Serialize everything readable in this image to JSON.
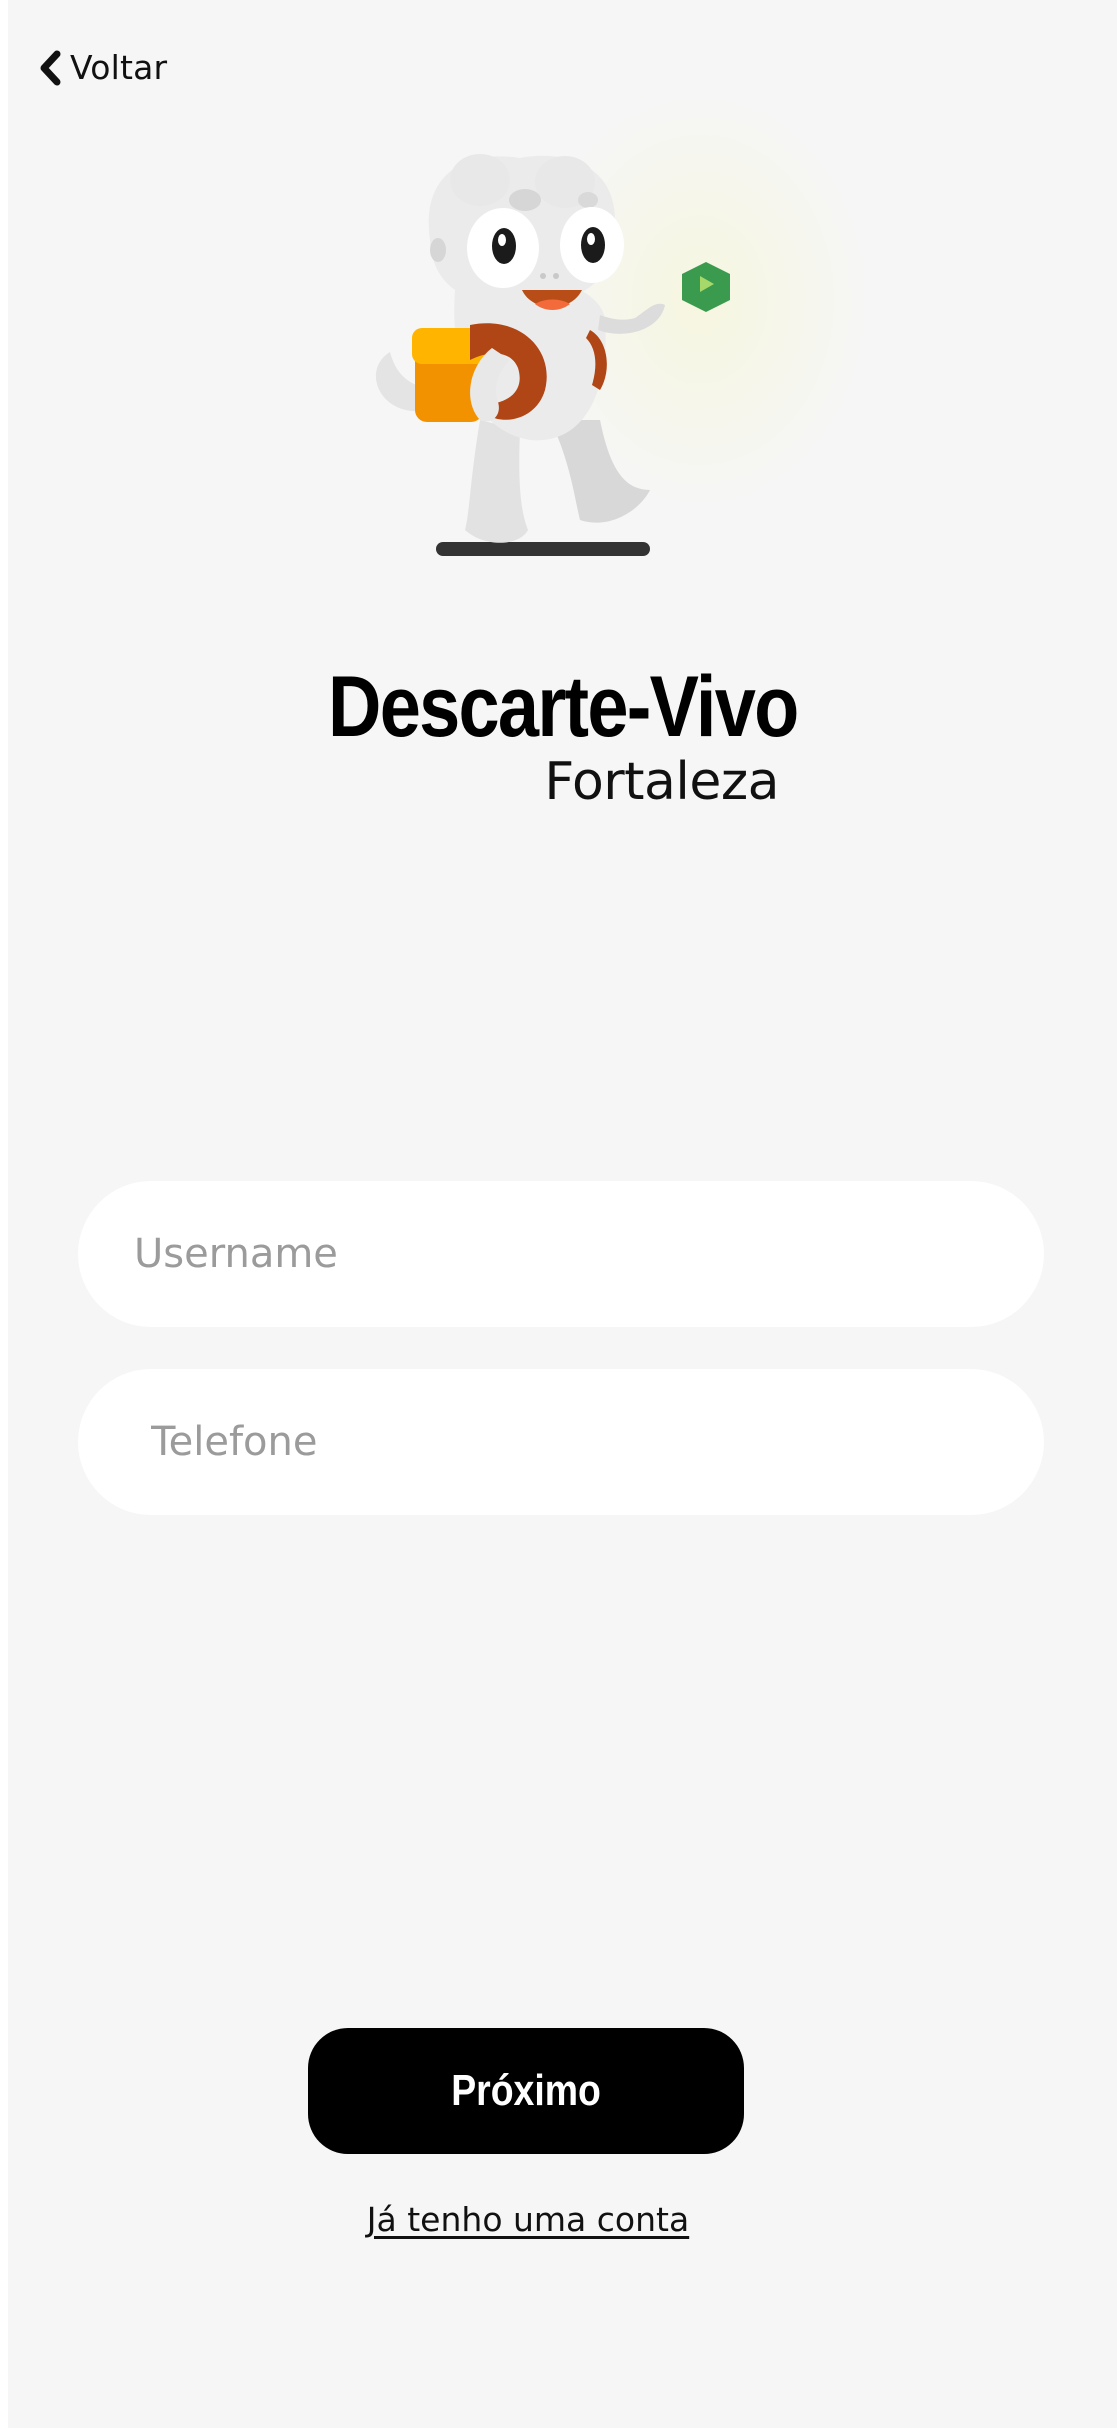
{
  "nav": {
    "back_label": "Voltar"
  },
  "brand": {
    "title": "Descarte-Vivo",
    "subtitle": "Fortaleza"
  },
  "form": {
    "username": {
      "placeholder": "Username",
      "value": ""
    },
    "phone": {
      "placeholder": "Telefone",
      "value": ""
    }
  },
  "actions": {
    "next_label": "Próximo",
    "login_link": "Já tenho uma conta"
  },
  "icons": {
    "back": "chevron-left-icon",
    "mascot": "mascot-illustration",
    "recycle_gem": "green-hexagon-icon"
  },
  "colors": {
    "background": "#f6f6f6",
    "input_bg": "#ffffff",
    "primary_button": "#000000",
    "mascot_bag": "#f39200",
    "mascot_bag_top": "#ffb400",
    "mascot_strap": "#b04616",
    "mascot_body": "#e6e6e6",
    "gem": "#3a9b4e"
  }
}
